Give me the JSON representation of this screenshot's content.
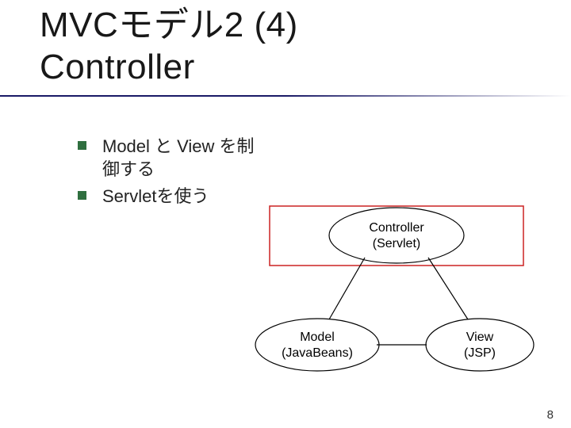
{
  "title_line1": "MVCモデル2 (4)",
  "title_line2": "Controller",
  "bullets": [
    "Model と View を制御する",
    "Servletを使う"
  ],
  "diagram": {
    "top": {
      "line1": "Controller",
      "line2": "(Servlet)"
    },
    "bottom_left": {
      "line1": "Model",
      "line2": "(JavaBeans)"
    },
    "bottom_right": {
      "line1": "View",
      "line2": "(JSP)"
    }
  },
  "slide_number": "8"
}
